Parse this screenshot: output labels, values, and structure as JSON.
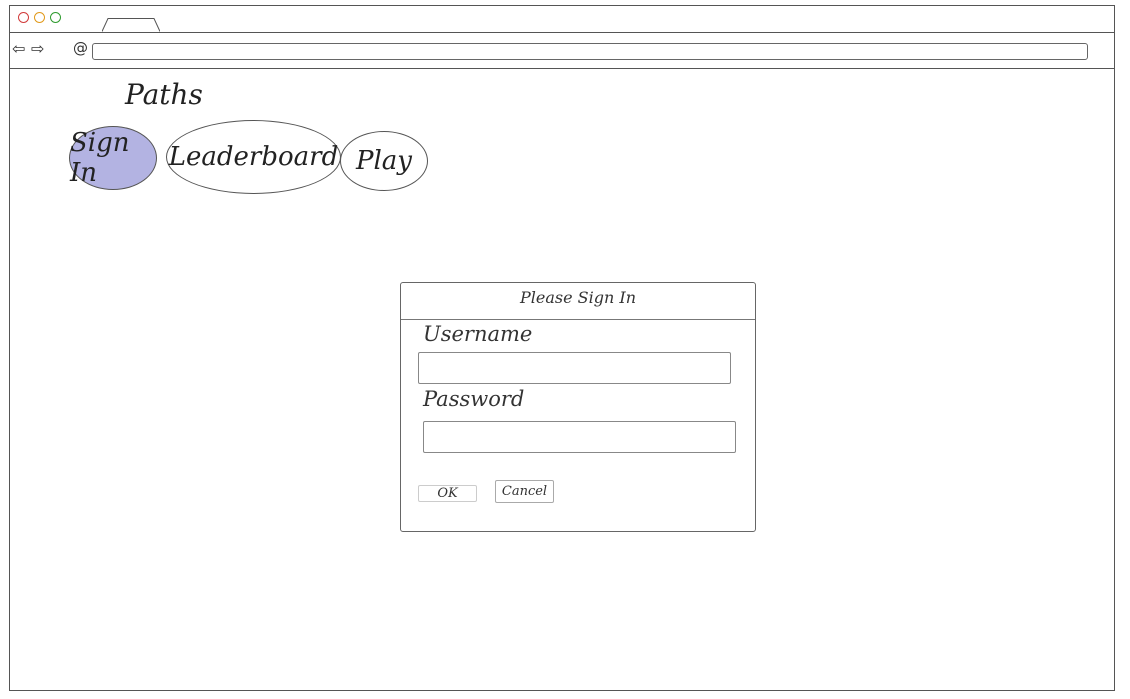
{
  "browser": {
    "back_icon": "⇦",
    "forward_icon": "⇨",
    "reload_icon": "@",
    "url": ""
  },
  "site": {
    "title": "Paths"
  },
  "nav": {
    "items": [
      {
        "label": "Sign In",
        "active": true
      },
      {
        "label": "Leaderboard",
        "active": false
      },
      {
        "label": "Play",
        "active": false
      }
    ],
    "active_color": "#b3b3e2"
  },
  "dialog": {
    "title": "Please Sign In",
    "username_label": "Username",
    "username_value": "",
    "password_label": "Password",
    "password_value": "",
    "ok_label": "OK",
    "cancel_label": "Cancel"
  }
}
